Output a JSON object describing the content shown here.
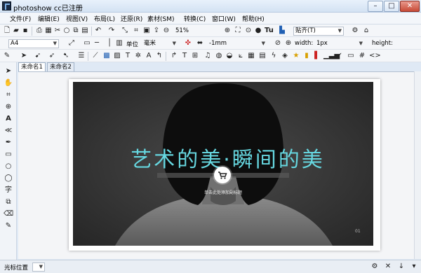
{
  "window": {
    "title": "photoshow cc已注册"
  },
  "menu": [
    "文件(F)",
    "编辑(E)",
    "视图(V)",
    "布局(L)",
    "还原(R)",
    "素材(SM)",
    "转换(C)",
    "窗口(W)",
    "帮助(H)"
  ],
  "toolbar1": {
    "zoom": "51%",
    "align": "贴齐(T)"
  },
  "toolbar2": {
    "paper": "A4",
    "unit_label": "单位",
    "unit": "毫米",
    "offset": "-1mm",
    "width_label": "width:",
    "width_value": "1px",
    "height_label": "height:"
  },
  "tabs": [
    "未命名1",
    "未命名2"
  ],
  "slide": {
    "headline": "艺术的美·瞬间的美",
    "subtitle": "单击此处添加副标题",
    "page": "01",
    "accent": "#66d7e0"
  },
  "status": {
    "label": "光标位置"
  }
}
